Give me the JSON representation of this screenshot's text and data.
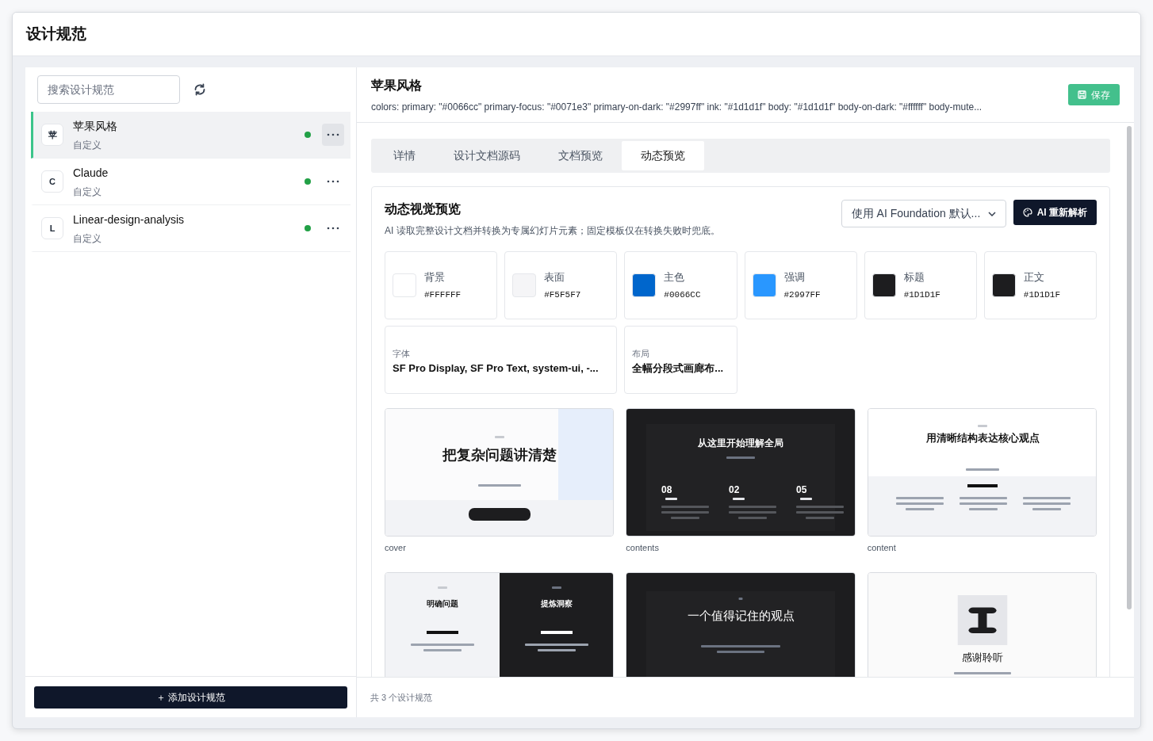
{
  "window": {
    "title": "设计规范"
  },
  "sidebar": {
    "search": {
      "placeholder": "搜索设计规范"
    },
    "items": [
      {
        "avatar": "苹",
        "name": "苹果风格",
        "subtitle": "自定义",
        "color": "#22a046",
        "selected": true
      },
      {
        "avatar": "C",
        "name": "Claude",
        "subtitle": "自定义",
        "color": "#22a046",
        "selected": false
      },
      {
        "avatar": "L",
        "name": "Linear-design-analysis",
        "subtitle": "自定义",
        "color": "#22a046",
        "selected": false
      }
    ],
    "add_button": "＋ 添加设计规范"
  },
  "detail": {
    "title": "苹果风格",
    "summary": "colors: primary: \"#0066cc\" primary-focus: \"#0071e3\" primary-on-dark: \"#2997ff\" ink: \"#1d1d1f\" body: \"#1d1d1f\" body-on-dark: \"#ffffff\" body-mute...",
    "save_button": "保存",
    "tabs": [
      {
        "label": "详情",
        "selected": false
      },
      {
        "label": "设计文档源码",
        "selected": false
      },
      {
        "label": "文档预览",
        "selected": false
      },
      {
        "label": "动态预览",
        "selected": true
      }
    ],
    "preview": {
      "title": "动态视觉预览",
      "description": "AI 读取完整设计文档并转换为专属幻灯片元素；固定模板仅在转换失败时兜底。",
      "template_select": "使用 AI Foundation 默认...",
      "reparse_button": "AI 重新解析",
      "colors": [
        {
          "label": "背景",
          "value": "#FFFFFF",
          "color": "#ffffff"
        },
        {
          "label": "表面",
          "value": "#F5F5F7",
          "color": "#f5f5f7"
        },
        {
          "label": "主色",
          "value": "#0066CC",
          "color": "#0066cc"
        },
        {
          "label": "强调",
          "value": "#2997FF",
          "color": "#2997ff"
        },
        {
          "label": "标题",
          "value": "#1D1D1F",
          "color": "#1d1d1f"
        },
        {
          "label": "正文",
          "value": "#1D1D1F",
          "color": "#1d1d1f"
        }
      ],
      "properties": [
        {
          "label": "字体",
          "value": "SF Pro Display, SF Pro Text, system-ui, -...",
          "wide": true
        },
        {
          "label": "布局",
          "value": "全幅分段式画廊布...",
          "wide": false
        }
      ],
      "slides": [
        {
          "kind": "cover",
          "caption": "cover",
          "title": "把复杂问题讲清楚"
        },
        {
          "kind": "contents",
          "caption": "contents",
          "title": "从这里开始理解全局",
          "items": [
            {
              "number": "08"
            },
            {
              "number": "02"
            },
            {
              "number": "05"
            }
          ]
        },
        {
          "kind": "content",
          "caption": "content",
          "title": "用清晰结构表达核心观点"
        },
        {
          "kind": "split",
          "panels": [
            {
              "kind": "light",
              "title": "明确问题"
            },
            {
              "kind": "dark",
              "title": "提炼洞察"
            }
          ]
        },
        {
          "kind": "quote",
          "title": "一个值得记住的观点"
        },
        {
          "kind": "closing",
          "title": "感谢聆听"
        }
      ]
    }
  },
  "status_bar": "共 3 个设计规范"
}
